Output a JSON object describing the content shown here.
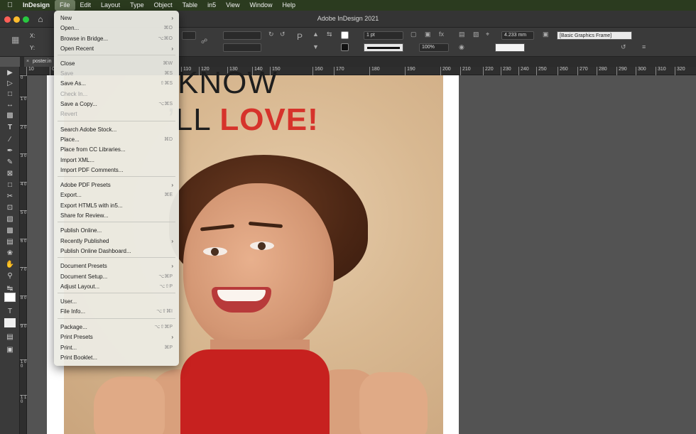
{
  "menubar": {
    "apple_icon": "apple-logo-icon",
    "app_name": "InDesign",
    "items": [
      "File",
      "Edit",
      "Layout",
      "Type",
      "Object",
      "Table",
      "in5",
      "View",
      "Window",
      "Help"
    ]
  },
  "window": {
    "title": "Adobe InDesign 2021",
    "traffic_colors": [
      "#fe5f57",
      "#febc2e",
      "#28c840"
    ]
  },
  "controlbar": {
    "x_label": "X:",
    "y_label": "Y:",
    "stroke_weight": "1 pt",
    "zoom": "100%",
    "gap_value": "4.233 mm",
    "frame_style": "[Basic Graphics Frame]"
  },
  "document": {
    "tab_label": "poster.in",
    "close_glyph": "×"
  },
  "ruler": {
    "h_ticks": [
      "10",
      "0",
      "210",
      "220",
      "230",
      "240",
      "250",
      "260",
      "270",
      "280",
      "290",
      "300",
      "310",
      "320"
    ],
    "h_ticks_under_menu": [
      "110",
      "120",
      "130",
      "140",
      "150",
      "160",
      "170",
      "180",
      "190",
      "200"
    ],
    "v_ticks": [
      "0",
      "1 0",
      "2 0",
      "3 0",
      "4 0",
      "5 0",
      "6 0",
      "7 0",
      "8 0",
      "9 0",
      "1 0 0",
      "1 1 0"
    ]
  },
  "artwork": {
    "line1": "KNOW",
    "line2_plain": "’LL ",
    "line2_accent": "LOVE!",
    "accent_color": "#d6332b"
  },
  "file_menu": {
    "items": [
      {
        "label": "New",
        "shortcut": "",
        "submenu": true,
        "disabled": false
      },
      {
        "label": "Open...",
        "shortcut": "⌘O",
        "submenu": false,
        "disabled": false
      },
      {
        "label": "Browse in Bridge...",
        "shortcut": "⌥⌘O",
        "submenu": false,
        "disabled": false
      },
      {
        "label": "Open Recent",
        "shortcut": "",
        "submenu": true,
        "disabled": false
      },
      {
        "label": "Close",
        "shortcut": "⌘W",
        "submenu": false,
        "disabled": false
      },
      {
        "label": "Save",
        "shortcut": "⌘S",
        "submenu": false,
        "disabled": true
      },
      {
        "label": "Save As...",
        "shortcut": "⇧⌘S",
        "submenu": false,
        "disabled": false
      },
      {
        "label": "Check In...",
        "shortcut": "",
        "submenu": false,
        "disabled": true
      },
      {
        "label": "Save a Copy...",
        "shortcut": "⌥⌘S",
        "submenu": false,
        "disabled": false
      },
      {
        "label": "Revert",
        "shortcut": "",
        "submenu": false,
        "disabled": true
      },
      {
        "label": "Search Adobe Stock...",
        "shortcut": "",
        "submenu": false,
        "disabled": false
      },
      {
        "label": "Place...",
        "shortcut": "⌘D",
        "submenu": false,
        "disabled": false
      },
      {
        "label": "Place from CC Libraries...",
        "shortcut": "",
        "submenu": false,
        "disabled": false
      },
      {
        "label": "Import XML...",
        "shortcut": "",
        "submenu": false,
        "disabled": false
      },
      {
        "label": "Import PDF Comments...",
        "shortcut": "",
        "submenu": false,
        "disabled": false
      },
      {
        "label": "Adobe PDF Presets",
        "shortcut": "",
        "submenu": true,
        "disabled": false
      },
      {
        "label": "Export...",
        "shortcut": "⌘E",
        "submenu": false,
        "disabled": false
      },
      {
        "label": "Export HTML5 with in5...",
        "shortcut": "",
        "submenu": false,
        "disabled": false
      },
      {
        "label": "Share for Review...",
        "shortcut": "",
        "submenu": false,
        "disabled": false
      },
      {
        "label": "Publish Online...",
        "shortcut": "",
        "submenu": false,
        "disabled": false
      },
      {
        "label": "Recently Published",
        "shortcut": "",
        "submenu": true,
        "disabled": false
      },
      {
        "label": "Publish Online Dashboard...",
        "shortcut": "",
        "submenu": false,
        "disabled": false
      },
      {
        "label": "Document Presets",
        "shortcut": "",
        "submenu": true,
        "disabled": false
      },
      {
        "label": "Document Setup...",
        "shortcut": "⌥⌘P",
        "submenu": false,
        "disabled": false
      },
      {
        "label": "Adjust Layout...",
        "shortcut": "⌥⇧P",
        "submenu": false,
        "disabled": false
      },
      {
        "label": "User...",
        "shortcut": "",
        "submenu": false,
        "disabled": false
      },
      {
        "label": "File Info...",
        "shortcut": "⌥⇧⌘I",
        "submenu": false,
        "disabled": false
      },
      {
        "label": "Package...",
        "shortcut": "⌥⇧⌘P",
        "submenu": false,
        "disabled": false
      },
      {
        "label": "Print Presets",
        "shortcut": "",
        "submenu": true,
        "disabled": false
      },
      {
        "label": "Print...",
        "shortcut": "⌘P",
        "submenu": false,
        "disabled": false
      },
      {
        "label": "Print Booklet...",
        "shortcut": "",
        "submenu": false,
        "disabled": false
      }
    ]
  }
}
